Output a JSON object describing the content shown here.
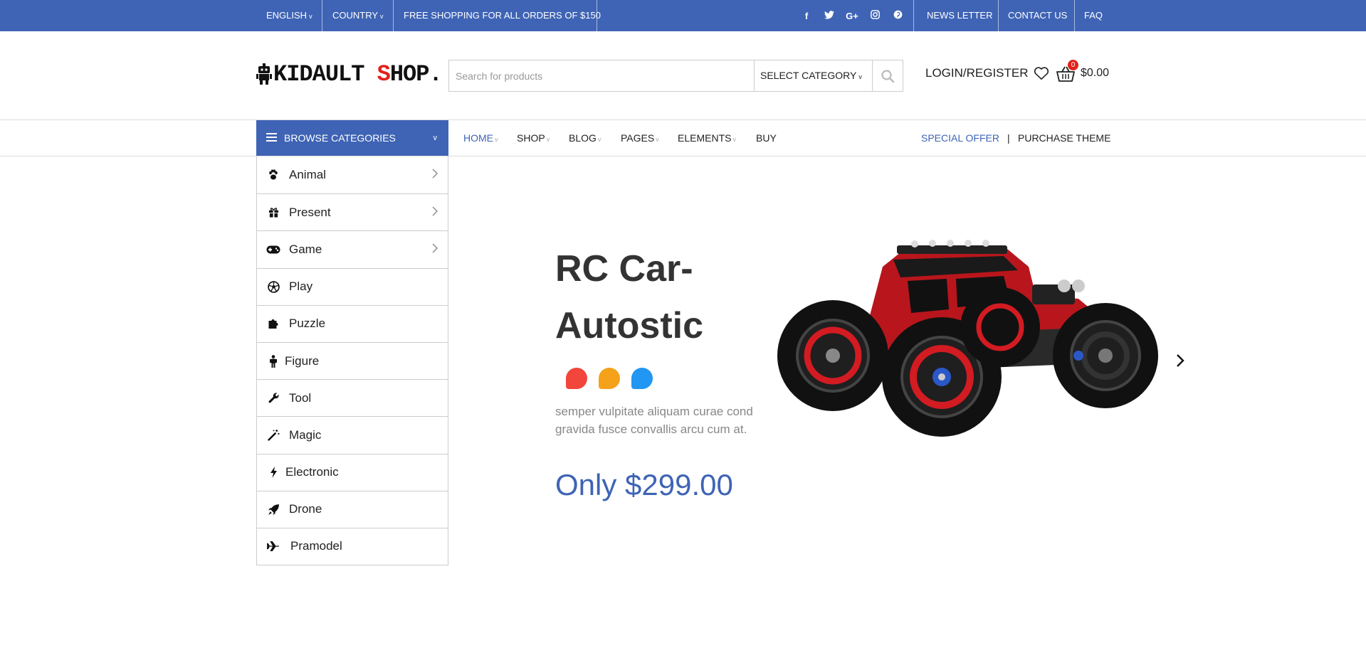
{
  "topbar": {
    "language": "ENGLISH",
    "country": "COUNTRY",
    "promo": "FREE SHOPPING FOR ALL ORDERS OF $150",
    "social_icons": [
      "facebook-icon",
      "twitter-icon",
      "google-plus-icon",
      "instagram-icon",
      "pinterest-icon"
    ],
    "links": [
      "NEWS LETTER",
      "CONTACT US",
      "FAQ"
    ]
  },
  "header": {
    "logo": {
      "text_main": "KIDAULT ",
      "text_accent": "S",
      "text_rest": "HOP."
    },
    "search": {
      "placeholder": "Search for products",
      "category": "SELECT CATEGORY"
    },
    "login": "LOGIN/REGISTER",
    "cart": {
      "count": "0",
      "total": "$0.00"
    }
  },
  "nav": {
    "browse_label": "BROWSE CATEGORIES",
    "items": [
      {
        "label": "HOME"
      },
      {
        "label": "SHOP"
      },
      {
        "label": "BLOG"
      },
      {
        "label": "PAGES"
      },
      {
        "label": "ELEMENTS"
      },
      {
        "label": "BUY"
      }
    ],
    "special_offer": "SPECIAL OFFER",
    "separator": "|",
    "purchase": "PURCHASE THEME"
  },
  "categories": [
    {
      "label": "Animal",
      "icon": "paw-icon"
    },
    {
      "label": "Present",
      "icon": "gift-icon"
    },
    {
      "label": "Game",
      "icon": "gamepad-icon"
    },
    {
      "label": "Play",
      "icon": "soccer-ball-icon"
    },
    {
      "label": "Puzzle",
      "icon": "puzzle-icon"
    },
    {
      "label": "Figure",
      "icon": "child-figure-icon"
    },
    {
      "label": "Tool",
      "icon": "wrench-icon"
    },
    {
      "label": "Magic",
      "icon": "magic-wand-icon"
    },
    {
      "label": "Electronic",
      "icon": "bolt-icon"
    },
    {
      "label": "Drone",
      "icon": "rocket-icon"
    },
    {
      "label": "Pramodel",
      "icon": "plane-icon"
    }
  ],
  "hero": {
    "title_line1": "RC Car-",
    "title_line2": "Autostic",
    "color_options": [
      "#f2453b",
      "#f5a11a",
      "#2196f3"
    ],
    "description_line1": "semper vulpitate aliquam curae cond",
    "description_line2": "gravida fusce convallis arcu cum at.",
    "price": "Only $299.00"
  },
  "colors": {
    "brand_blue": "#3f64b5",
    "logo_red": "#e2211c"
  }
}
